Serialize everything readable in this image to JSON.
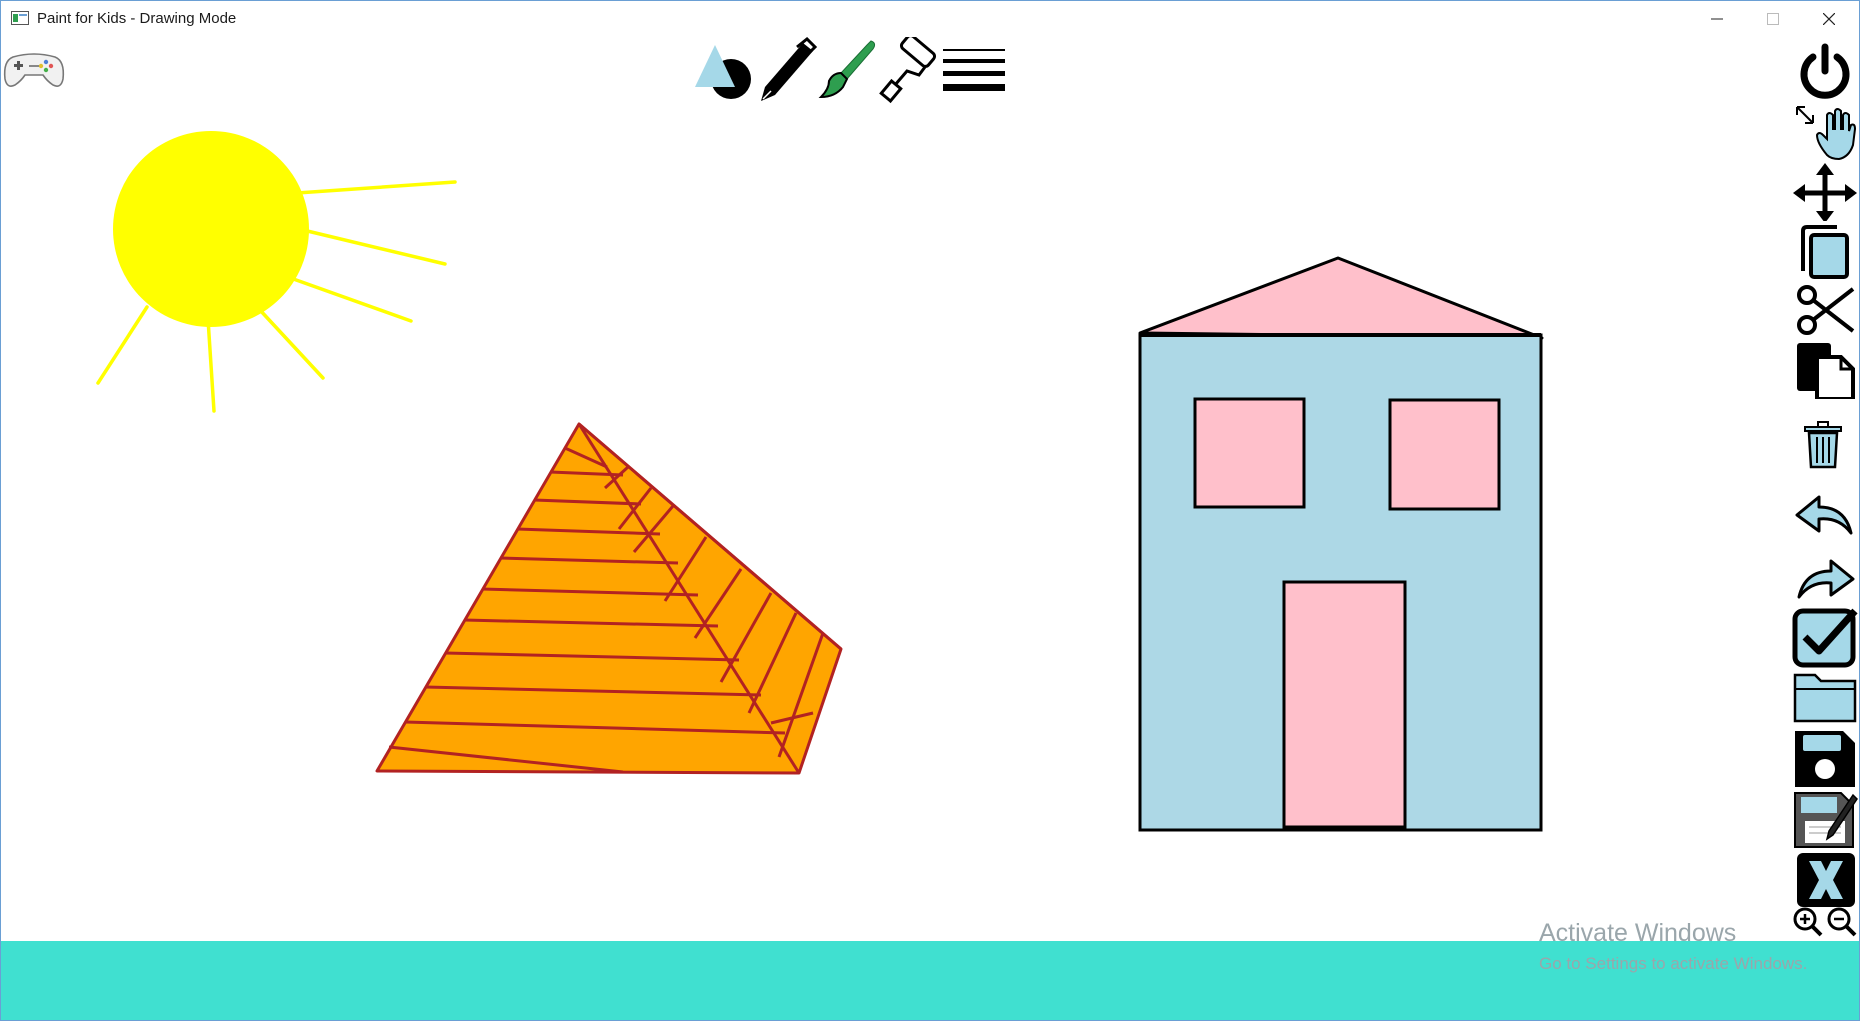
{
  "window": {
    "title": "Paint for Kids - Drawing Mode",
    "controls": [
      "minimize",
      "maximize",
      "close"
    ]
  },
  "top_toolbar": {
    "tools": [
      {
        "name": "shapes",
        "icon": "shapes-icon"
      },
      {
        "name": "pen",
        "icon": "pen-icon"
      },
      {
        "name": "brush",
        "icon": "brush-icon"
      },
      {
        "name": "fill",
        "icon": "paint-roller-icon"
      },
      {
        "name": "line width",
        "icon": "line-width-icon"
      }
    ]
  },
  "mode_switch": {
    "icon": "gamepad-icon",
    "label": "Play Mode"
  },
  "right_toolbar": {
    "tools": [
      {
        "name": "exit",
        "icon": "power-icon"
      },
      {
        "name": "resize",
        "icon": "hand-resize-icon"
      },
      {
        "name": "move",
        "icon": "move-arrows-icon"
      },
      {
        "name": "copy",
        "icon": "copy-icon"
      },
      {
        "name": "cut",
        "icon": "scissors-icon"
      },
      {
        "name": "paste",
        "icon": "paste-icon"
      },
      {
        "name": "delete",
        "icon": "trash-icon"
      },
      {
        "name": "undo",
        "icon": "undo-icon"
      },
      {
        "name": "redo",
        "icon": "redo-icon"
      },
      {
        "name": "select",
        "icon": "checkbox-icon"
      },
      {
        "name": "open",
        "icon": "folder-icon"
      },
      {
        "name": "save",
        "icon": "save-icon"
      },
      {
        "name": "save as",
        "icon": "save-as-icon"
      },
      {
        "name": "clear all",
        "icon": "clear-x-icon"
      },
      {
        "name": "zoom",
        "icon": "zoom-icon"
      }
    ]
  },
  "canvas": {
    "shapes": [
      {
        "kind": "sun",
        "fill": "#ffff00"
      },
      {
        "kind": "pyramid",
        "fill": "#ffa500",
        "stroke": "#b22222"
      },
      {
        "kind": "house",
        "wall": "#add8e6",
        "roof": "#ffc0cb",
        "window": "#ffc0cb",
        "door": "#ffc0cb",
        "stroke": "#000000"
      }
    ]
  },
  "status_bar": {
    "color": "#40e0d0"
  },
  "watermark": {
    "line1": "Activate Windows",
    "line2": "Go to Settings to activate Windows."
  },
  "colors": {
    "icon_blue": "#a5d8e8",
    "brush_green": "#2e9e4f",
    "window_border": "#6a9fd4"
  }
}
